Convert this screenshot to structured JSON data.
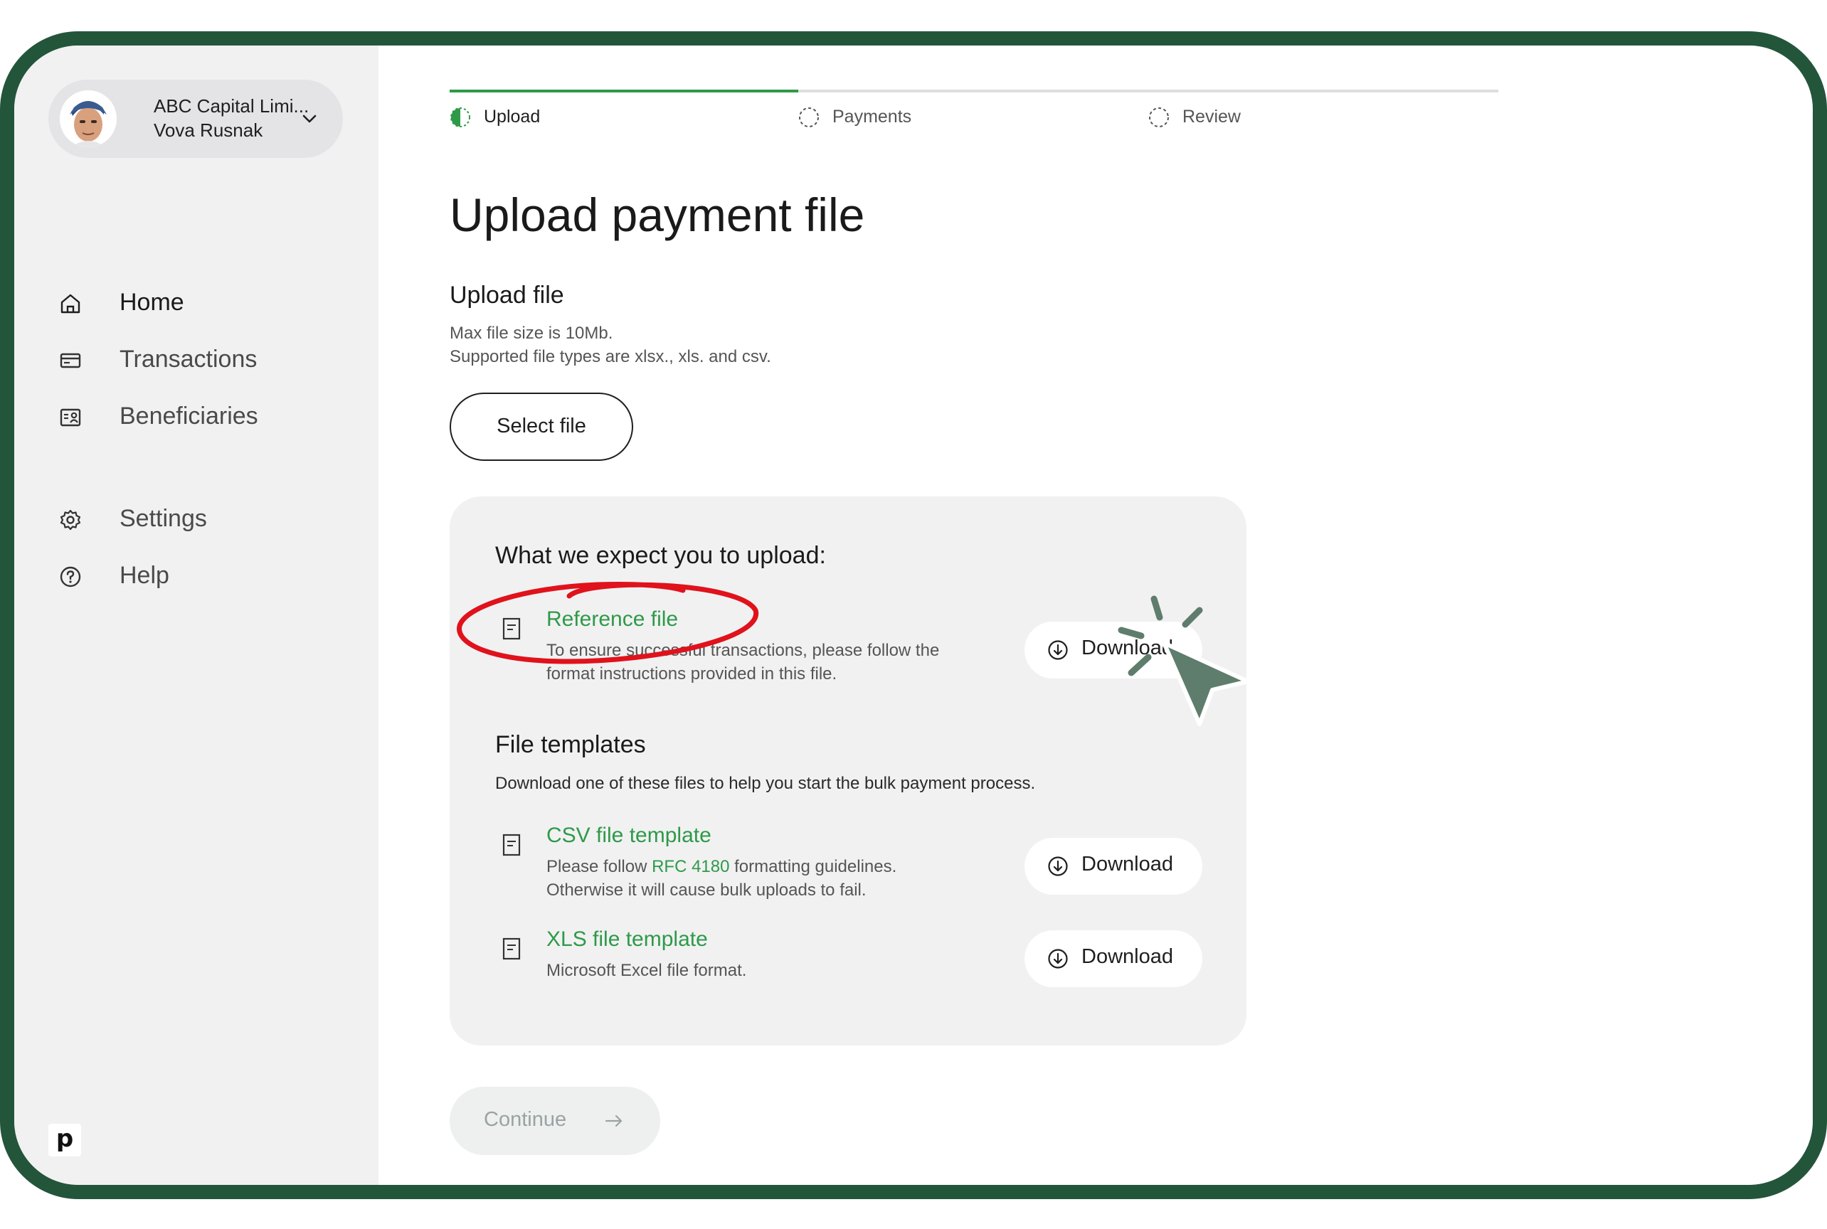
{
  "account": {
    "company": "ABC Capital Limi...",
    "user": "Vova Rusnak",
    "chevron_icon": "chevron-down-icon"
  },
  "nav": {
    "items": [
      {
        "label": "Home",
        "icon": "home-icon"
      },
      {
        "label": "Transactions",
        "icon": "card-icon"
      },
      {
        "label": "Beneficiaries",
        "icon": "contact-card-icon"
      },
      {
        "label": "Settings",
        "icon": "gear-icon"
      },
      {
        "label": "Help",
        "icon": "help-circle-icon"
      }
    ],
    "brand_logo": "p"
  },
  "steps": [
    {
      "label": "Upload",
      "state": "active"
    },
    {
      "label": "Payments",
      "state": "pending"
    },
    {
      "label": "Review",
      "state": "pending"
    }
  ],
  "page": {
    "title": "Upload payment file",
    "section_title": "Upload file",
    "help_line1": "Max file size is 10Mb.",
    "help_line2": "Supported file types are xlsx., xls. and csv.",
    "select_button": "Select file"
  },
  "card": {
    "title": "What we expect you to upload:",
    "reference": {
      "link": "Reference file",
      "desc_line1": "To ensure successful transactions, please follow the",
      "desc_line2": "format instructions provided in this file.",
      "button": "Download"
    },
    "templates_title": "File templates",
    "templates_desc": "Download one of these files to help you start the bulk payment process.",
    "csv": {
      "link": "CSV file template",
      "desc_prefix": "Please follow ",
      "desc_link": "RFC 4180",
      "desc_suffix": " formatting guidelines.",
      "desc_line2": "Otherwise it will cause bulk uploads to fail.",
      "button": "Download"
    },
    "xls": {
      "link": "XLS file template",
      "desc": "Microsoft Excel file format.",
      "button": "Download"
    }
  },
  "continue_button": "Continue",
  "colors": {
    "frame": "#23553a",
    "accent_green": "#2e9a48",
    "annotation_red": "#e0121b",
    "cursor": "#5f7d6c"
  }
}
